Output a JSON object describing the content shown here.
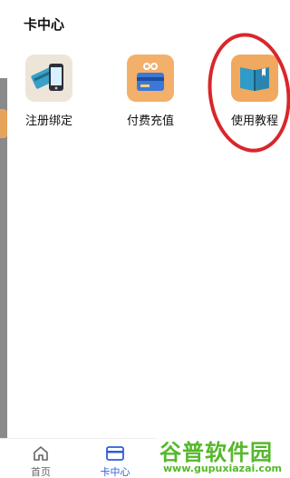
{
  "page": {
    "title": "卡中心"
  },
  "tiles": [
    {
      "label": "注册绑定",
      "icon": "card-phone-icon"
    },
    {
      "label": "付费充值",
      "icon": "payment-card-icon"
    },
    {
      "label": "使用教程",
      "icon": "book-icon"
    }
  ],
  "nav": {
    "home": {
      "label": "首页",
      "icon": "home-icon"
    },
    "card": {
      "label": "卡中心",
      "icon": "card-icon"
    }
  },
  "watermark": {
    "main": "谷普软件园",
    "sub": "www.gupuxiazai.com"
  },
  "colors": {
    "accent": "#2b5fd9",
    "annotation": "#d9262b",
    "tile_orange": "#f3b06a",
    "watermark": "#55b82a"
  }
}
